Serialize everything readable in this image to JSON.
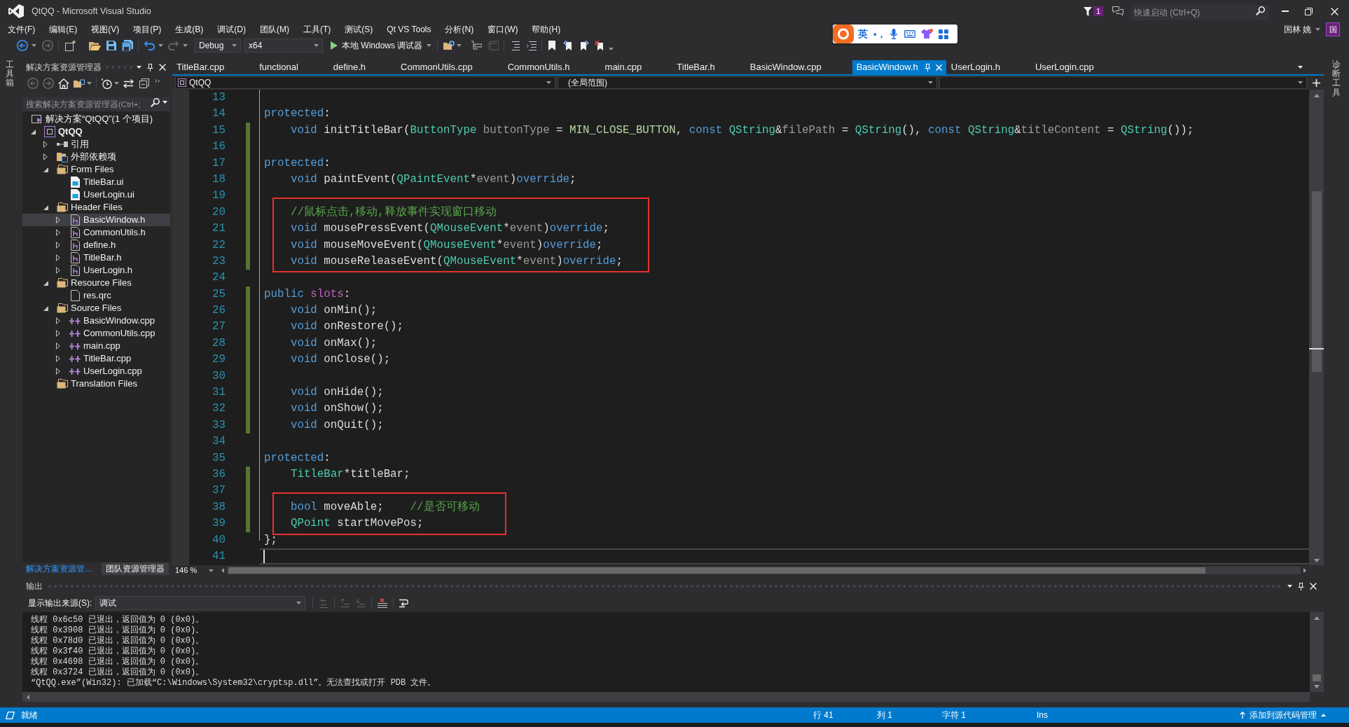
{
  "window": {
    "title": "QtQQ - Microsoft Visual Studio",
    "notification_count": "1",
    "quick_launch": {
      "placeholder": "快速启动 (Ctrl+Q)"
    }
  },
  "menu": [
    "文件(F)",
    "编辑(E)",
    "视图(V)",
    "项目(P)",
    "生成(B)",
    "调试(D)",
    "团队(M)",
    "工具(T)",
    "测试(S)",
    "Qt VS Tools",
    "分析(N)",
    "窗口(W)",
    "帮助(H)"
  ],
  "account": {
    "name": "国林 姚",
    "avatar": "国"
  },
  "ime_bar": {
    "mode": "英",
    "punctuation": "•，"
  },
  "toolbar": {
    "configuration": "Debug",
    "platform": "x64",
    "debugger": "本地 Windows 调试器"
  },
  "side_tabs": {
    "left": "工具箱",
    "right": "诊断工具"
  },
  "solution_explorer": {
    "title": "解决方案资源管理器",
    "search": {
      "placeholder": "搜索解决方案资源管理器(Ctrl+;"
    },
    "tree": [
      {
        "label": "解决方案“QtQQ”(1 个项目)",
        "kind": "solution",
        "selected": false,
        "children": [
          {
            "label": "QtQQ",
            "kind": "project",
            "expanded": true,
            "selected": false,
            "children": [
              {
                "label": "引用",
                "kind": "references",
                "expanded": false,
                "selected": false
              },
              {
                "label": "外部依赖项",
                "kind": "dependencies",
                "expanded": false,
                "selected": false
              },
              {
                "label": "Form Files",
                "kind": "folder",
                "expanded": true,
                "selected": false,
                "children": [
                  {
                    "label": "TitleBar.ui",
                    "kind": "form",
                    "selected": false
                  },
                  {
                    "label": "UserLogin.ui",
                    "kind": "form",
                    "selected": false
                  }
                ]
              },
              {
                "label": "Header Files",
                "kind": "folder",
                "expanded": true,
                "selected": false,
                "children": [
                  {
                    "label": "BasicWindow.h",
                    "kind": "header",
                    "expanded": false,
                    "selected": true
                  },
                  {
                    "label": "CommonUtils.h",
                    "kind": "header",
                    "expanded": false,
                    "selected": false
                  },
                  {
                    "label": "define.h",
                    "kind": "header",
                    "expanded": false,
                    "selected": false
                  },
                  {
                    "label": "TitleBar.h",
                    "kind": "header",
                    "expanded": false,
                    "selected": false
                  },
                  {
                    "label": "UserLogin.h",
                    "kind": "header",
                    "expanded": false,
                    "selected": false
                  }
                ]
              },
              {
                "label": "Resource Files",
                "kind": "folder",
                "expanded": true,
                "selected": false,
                "children": [
                  {
                    "label": "res.qrc",
                    "kind": "resource",
                    "selected": false
                  }
                ]
              },
              {
                "label": "Source Files",
                "kind": "folder",
                "expanded": true,
                "selected": false,
                "children": [
                  {
                    "label": "BasicWindow.cpp",
                    "kind": "source",
                    "expanded": false,
                    "selected": false
                  },
                  {
                    "label": "CommonUtils.cpp",
                    "kind": "source",
                    "expanded": false,
                    "selected": false
                  },
                  {
                    "label": "main.cpp",
                    "kind": "source",
                    "expanded": false,
                    "selected": false
                  },
                  {
                    "label": "TitleBar.cpp",
                    "kind": "source",
                    "expanded": false,
                    "selected": false
                  },
                  {
                    "label": "UserLogin.cpp",
                    "kind": "source",
                    "expanded": false,
                    "selected": false
                  }
                ]
              },
              {
                "label": "Translation Files",
                "kind": "folder",
                "selected": false
              }
            ]
          }
        ]
      }
    ],
    "bottom_tabs": [
      {
        "label": "解决方案资源管...",
        "selected": true
      },
      {
        "label": "团队资源管理器",
        "selected": false
      }
    ]
  },
  "editor": {
    "tabs": [
      {
        "label": "TitleBar.cpp",
        "selected": false
      },
      {
        "label": "functional",
        "selected": false
      },
      {
        "label": "define.h",
        "selected": false
      },
      {
        "label": "CommonUtils.cpp",
        "selected": false
      },
      {
        "label": "CommonUtils.h",
        "selected": false
      },
      {
        "label": "main.cpp",
        "selected": false
      },
      {
        "label": "TitleBar.h",
        "selected": false
      },
      {
        "label": "BasicWindow.cpp",
        "selected": false
      },
      {
        "label": "BasicWindow.h",
        "selected": true
      },
      {
        "label": "UserLogin.h",
        "selected": false
      },
      {
        "label": "UserLogin.cpp",
        "selected": false
      }
    ],
    "project": "QtQQ",
    "scope": "(全局范围)",
    "zoom": "146 %",
    "blocks": [
      {
        "kind": "plain",
        "lines": [
          {
            "number": "13",
            "changed": false
          },
          {
            "number": "14",
            "changed": false,
            "tokens": [
              {
                "kind": "keyword",
                "text": "protected"
              },
              {
                "kind": "plain",
                "text": ":"
              }
            ]
          },
          {
            "number": "15",
            "changed": true,
            "tokens": [
              {
                "kind": "keyword",
                "text": "    void"
              },
              {
                "kind": "plain",
                "text": " initTitleBar("
              },
              {
                "kind": "type",
                "text": "ButtonType"
              },
              {
                "kind": "param",
                "text": " buttonType"
              },
              {
                "kind": "plain",
                "text": " = "
              },
              {
                "kind": "enum",
                "text": "MIN_CLOSE_BUTTON"
              },
              {
                "kind": "plain",
                "text": ", "
              },
              {
                "kind": "keyword",
                "text": "const"
              },
              {
                "kind": "type",
                "text": " QString"
              },
              {
                "kind": "plain",
                "text": "&"
              },
              {
                "kind": "param",
                "text": "filePath"
              },
              {
                "kind": "plain",
                "text": " = "
              },
              {
                "kind": "type",
                "text": "QString"
              },
              {
                "kind": "plain",
                "text": "(), "
              },
              {
                "kind": "keyword",
                "text": "const"
              },
              {
                "kind": "type",
                "text": " QString"
              },
              {
                "kind": "plain",
                "text": "&"
              },
              {
                "kind": "param",
                "text": "titleContent"
              },
              {
                "kind": "plain",
                "text": " = "
              },
              {
                "kind": "type",
                "text": "QString"
              },
              {
                "kind": "plain",
                "text": "());"
              }
            ]
          },
          {
            "number": "16",
            "changed": true
          },
          {
            "number": "17",
            "changed": true,
            "tokens": [
              {
                "kind": "keyword",
                "text": "protected"
              },
              {
                "kind": "plain",
                "text": ":"
              }
            ]
          },
          {
            "number": "18",
            "changed": true,
            "tokens": [
              {
                "kind": "keyword",
                "text": "    void"
              },
              {
                "kind": "plain",
                "text": " paintEvent("
              },
              {
                "kind": "type",
                "text": "QPaintEvent"
              },
              {
                "kind": "plain",
                "text": "*"
              },
              {
                "kind": "param",
                "text": "event"
              },
              {
                "kind": "plain",
                "text": ")"
              },
              {
                "kind": "keyword",
                "text": "override"
              },
              {
                "kind": "plain",
                "text": ";"
              }
            ]
          },
          {
            "number": "19",
            "changed": true
          }
        ]
      },
      {
        "kind": "framed",
        "lines": [
          {
            "number": "20",
            "changed": true,
            "tokens": [
              {
                "kind": "comment",
                "text": "    //鼠标点击,移动,释放事件实现窗口移动"
              }
            ]
          },
          {
            "number": "21",
            "changed": true,
            "tokens": [
              {
                "kind": "keyword",
                "text": "    void"
              },
              {
                "kind": "plain",
                "text": " mousePressEvent("
              },
              {
                "kind": "type",
                "text": "QMouseEvent"
              },
              {
                "kind": "plain",
                "text": "*"
              },
              {
                "kind": "param",
                "text": "event"
              },
              {
                "kind": "plain",
                "text": ")"
              },
              {
                "kind": "keyword",
                "text": "override"
              },
              {
                "kind": "plain",
                "text": ";"
              }
            ]
          },
          {
            "number": "22",
            "changed": true,
            "tokens": [
              {
                "kind": "keyword",
                "text": "    void"
              },
              {
                "kind": "plain",
                "text": " mouseMoveEvent("
              },
              {
                "kind": "type",
                "text": "QMouseEvent"
              },
              {
                "kind": "plain",
                "text": "*"
              },
              {
                "kind": "param",
                "text": "event"
              },
              {
                "kind": "plain",
                "text": ")"
              },
              {
                "kind": "keyword",
                "text": "override"
              },
              {
                "kind": "plain",
                "text": ";"
              }
            ]
          },
          {
            "number": "23",
            "changed": true,
            "tokens": [
              {
                "kind": "keyword",
                "text": "    void"
              },
              {
                "kind": "plain",
                "text": " mouseReleaseEvent("
              },
              {
                "kind": "type",
                "text": "QMouseEvent"
              },
              {
                "kind": "plain",
                "text": "*"
              },
              {
                "kind": "param",
                "text": "event"
              },
              {
                "kind": "plain",
                "text": ")"
              },
              {
                "kind": "keyword",
                "text": "override"
              },
              {
                "kind": "plain",
                "text": ";"
              }
            ]
          }
        ]
      },
      {
        "kind": "plain",
        "lines": [
          {
            "number": "24",
            "changed": false
          },
          {
            "number": "25",
            "changed": true,
            "tokens": [
              {
                "kind": "keyword",
                "text": "public"
              },
              {
                "kind": "macro",
                "text": " slots"
              },
              {
                "kind": "plain",
                "text": ":"
              }
            ]
          },
          {
            "number": "26",
            "changed": true,
            "tokens": [
              {
                "kind": "keyword",
                "text": "    void"
              },
              {
                "kind": "plain",
                "text": " onMin();"
              }
            ]
          },
          {
            "number": "27",
            "changed": true,
            "tokens": [
              {
                "kind": "keyword",
                "text": "    void"
              },
              {
                "kind": "plain",
                "text": " onRestore();"
              }
            ]
          },
          {
            "number": "28",
            "changed": true,
            "tokens": [
              {
                "kind": "keyword",
                "text": "    void"
              },
              {
                "kind": "plain",
                "text": " onMax();"
              }
            ]
          },
          {
            "number": "29",
            "changed": true,
            "tokens": [
              {
                "kind": "keyword",
                "text": "    void"
              },
              {
                "kind": "plain",
                "text": " onClose();"
              }
            ]
          },
          {
            "number": "30",
            "changed": true
          },
          {
            "number": "31",
            "changed": true,
            "tokens": [
              {
                "kind": "keyword",
                "text": "    void"
              },
              {
                "kind": "plain",
                "text": " onHide();"
              }
            ]
          },
          {
            "number": "32",
            "changed": true,
            "tokens": [
              {
                "kind": "keyword",
                "text": "    void"
              },
              {
                "kind": "plain",
                "text": " onShow();"
              }
            ]
          },
          {
            "number": "33",
            "changed": true,
            "tokens": [
              {
                "kind": "keyword",
                "text": "    void"
              },
              {
                "kind": "plain",
                "text": " onQuit();"
              }
            ]
          },
          {
            "number": "34",
            "changed": false
          },
          {
            "number": "35",
            "changed": false,
            "tokens": [
              {
                "kind": "keyword",
                "text": "protected"
              },
              {
                "kind": "plain",
                "text": ":"
              }
            ]
          },
          {
            "number": "36",
            "changed": true,
            "tokens": [
              {
                "kind": "type",
                "text": "    TitleBar"
              },
              {
                "kind": "plain",
                "text": "*titleBar;"
              }
            ]
          },
          {
            "number": "37",
            "changed": true
          }
        ]
      },
      {
        "kind": "framed",
        "lines": [
          {
            "number": "38",
            "changed": true,
            "tokens": [
              {
                "kind": "keyword",
                "text": "    bool"
              },
              {
                "kind": "plain",
                "text": " moveAble;    "
              },
              {
                "kind": "comment",
                "text": "//是否可移动"
              }
            ]
          },
          {
            "number": "39",
            "changed": true,
            "tokens": [
              {
                "kind": "type",
                "text": "    QPoint"
              },
              {
                "kind": "plain",
                "text": " startMovePos;"
              }
            ]
          }
        ]
      },
      {
        "kind": "plain",
        "lines": [
          {
            "number": "40",
            "changed": false,
            "tokens": [
              {
                "kind": "plain",
                "text": "};"
              }
            ]
          },
          {
            "number": "41",
            "changed": false,
            "cursor": true
          }
        ]
      }
    ]
  },
  "output": {
    "title": "输出",
    "source_label": "显示输出来源(S):",
    "source": "调试",
    "lines": [
      "线程 0x6c50 已退出，返回值为 0 (0x0)。",
      "线程 0x3908 已退出，返回值为 0 (0x0)。",
      "线程 0x78d0 已退出，返回值为 0 (0x0)。",
      "线程 0x3f40 已退出，返回值为 0 (0x0)。",
      "线程 0x4698 已退出，返回值为 0 (0x0)。",
      "线程 0x3724 已退出，返回值为 0 (0x0)。",
      "“QtQQ.exe”(Win32): 已加载“C:\\Windows\\System32\\cryptsp.dll”。无法查找或打开 PDB 文件。"
    ]
  },
  "status_bar": {
    "message": "就绪",
    "line": "行 41",
    "column": "列 1",
    "character": "字符 1",
    "mode": "Ins",
    "source_control": "添加到源代码管理"
  }
}
